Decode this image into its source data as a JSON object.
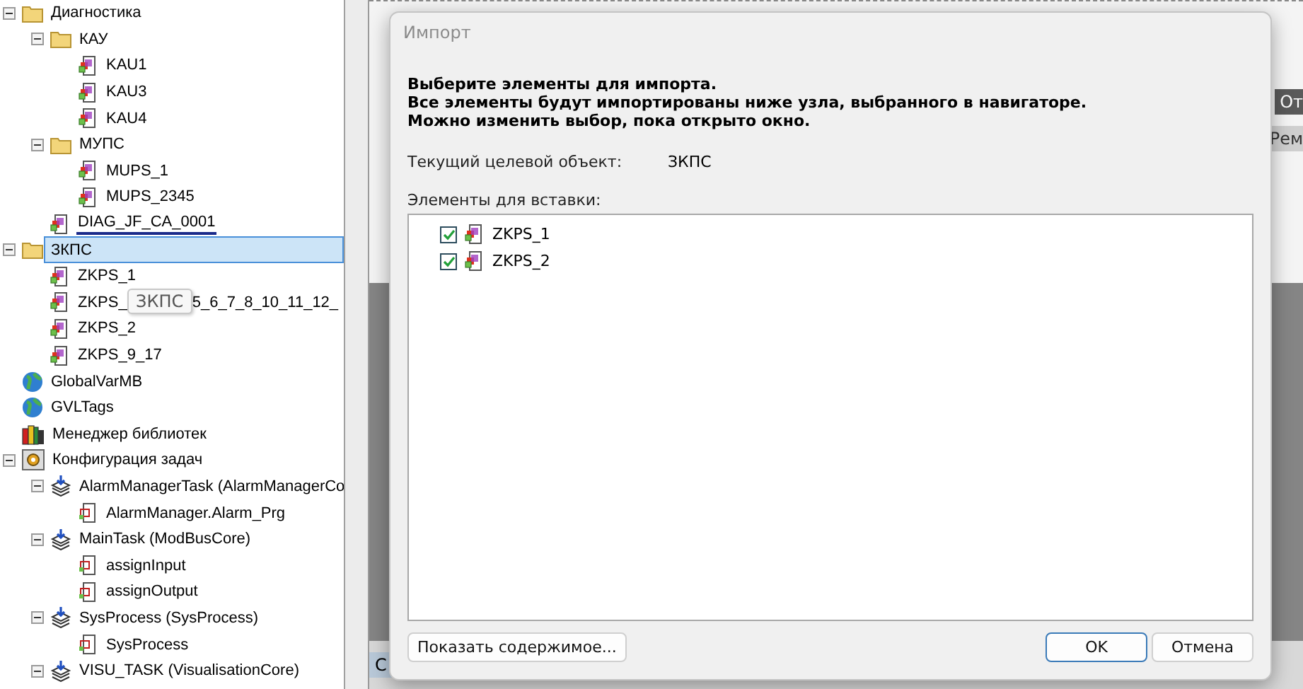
{
  "tree": [
    {
      "label": "Диагностика",
      "kind": "folder",
      "expanded": true,
      "selected": false,
      "children": [
        {
          "label": "КАУ",
          "kind": "folder",
          "expanded": true,
          "selected": false,
          "children": [
            {
              "label": "KAU1",
              "kind": "pou",
              "selected": false
            },
            {
              "label": "KAU3",
              "kind": "pou",
              "selected": false
            },
            {
              "label": "KAU4",
              "kind": "pou",
              "selected": false
            }
          ]
        },
        {
          "label": "МУПС",
          "kind": "folder",
          "expanded": true,
          "selected": false,
          "children": [
            {
              "label": "MUPS_1",
              "kind": "pou",
              "selected": false
            },
            {
              "label": "MUPS_2345",
              "kind": "pou",
              "selected": false
            }
          ]
        },
        {
          "label": "DIAG_JF_CA_0001",
          "kind": "pou",
          "selected": false,
          "underlined": true
        }
      ]
    },
    {
      "label": "ЗКПС",
      "kind": "folder",
      "expanded": true,
      "selected": true,
      "children": [
        {
          "label": "ZKPS_1",
          "kind": "pou",
          "selected": false
        },
        {
          "label": "ZKPS_",
          "label_tail": "5_6_7_8_10_11_12_",
          "kind": "pou",
          "selected": false,
          "tooltip": "ЗКПС"
        },
        {
          "label": "ZKPS_2",
          "kind": "pou",
          "selected": false
        },
        {
          "label": "ZKPS_9_17",
          "kind": "pou",
          "selected": false
        }
      ]
    },
    {
      "label": "GlobalVarMB",
      "kind": "gvl",
      "selected": false
    },
    {
      "label": "GVLTags",
      "kind": "gvl",
      "selected": false
    },
    {
      "label": "Менеджер библиотек",
      "kind": "library",
      "selected": false
    },
    {
      "label": "Конфигурация задач",
      "kind": "taskconfig",
      "expanded": true,
      "selected": false,
      "children": [
        {
          "label": "AlarmManagerTask (AlarmManagerCo",
          "kind": "task",
          "expanded": true,
          "selected": false,
          "children": [
            {
              "label": "AlarmManager.Alarm_Prg",
              "kind": "call",
              "selected": false
            }
          ]
        },
        {
          "label": "MainTask (ModBusCore)",
          "kind": "task",
          "expanded": true,
          "selected": false,
          "children": [
            {
              "label": "assignInput",
              "kind": "call",
              "selected": false
            },
            {
              "label": "assignOutput",
              "kind": "call",
              "selected": false
            }
          ]
        },
        {
          "label": "SysProcess (SysProcess)",
          "kind": "task",
          "expanded": true,
          "selected": false,
          "children": [
            {
              "label": "SysProcess",
              "kind": "call",
              "selected": false
            }
          ]
        },
        {
          "label": "VISU_TASK (VisualisationCore)",
          "kind": "task",
          "expanded": true,
          "selected": false
        }
      ]
    }
  ],
  "background_fragments": [
    "От",
    "Рем"
  ],
  "bottom_tab": "С",
  "dialog": {
    "title": "Импорт",
    "instructions": [
      "Выберите элементы для импорта.",
      "Все элементы будут импортированы ниже узла, выбранного в навигаторе.",
      "Можно изменить выбор, пока открыто окно."
    ],
    "target_label": "Текущий целевой объект:",
    "target_value": "ЗКПС",
    "list_label": "Элементы для вставки:",
    "items": [
      {
        "label": "ZKPS_1",
        "checked": true
      },
      {
        "label": "ZKPS_2",
        "checked": true
      }
    ],
    "show_button": "Показать содержимое...",
    "ok_button": "OK",
    "cancel_button": "Отмена"
  }
}
